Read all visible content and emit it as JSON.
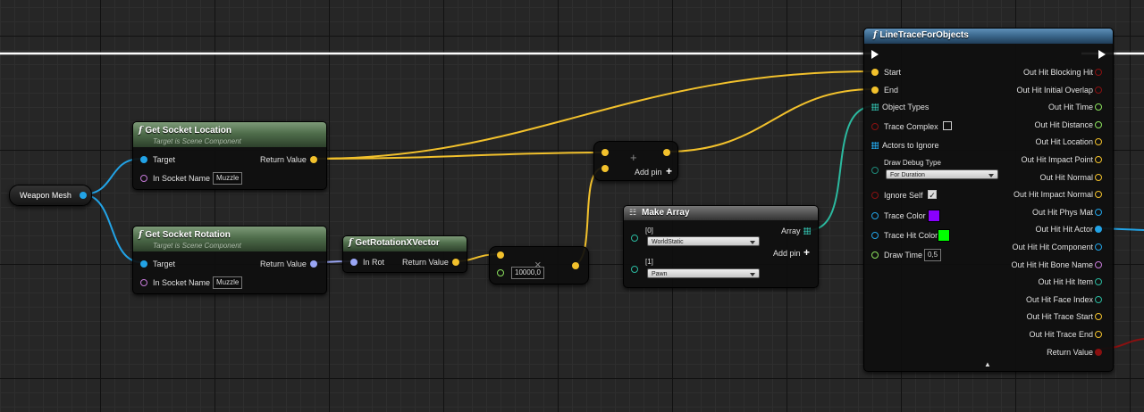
{
  "colors": {
    "exec": "#ffffff",
    "vector": "#f2c12c",
    "rotator": "#9aa6f5",
    "object": "#22a3e6",
    "name": "#c57ad8",
    "bool": "#8a1010",
    "float": "#8ce25d",
    "struct": "#2bb99f"
  },
  "weapon_mesh": {
    "label": "Weapon Mesh"
  },
  "get_socket_location": {
    "title": "Get Socket Location",
    "subtitle": "Target is Scene Component",
    "target": "Target",
    "socket_name": "In Socket Name",
    "socket_value": "Muzzle",
    "return_value": "Return Value"
  },
  "get_socket_rotation": {
    "title": "Get Socket Rotation",
    "subtitle": "Target is Scene Component",
    "target": "Target",
    "socket_name": "In Socket Name",
    "socket_value": "Muzzle",
    "return_value": "Return Value"
  },
  "get_rotation_x": {
    "title": "GetRotationXVector",
    "in_rot": "In Rot",
    "return_value": "Return Value"
  },
  "multiply": {
    "symbol": "×",
    "value": "10000,0"
  },
  "add": {
    "symbol": "+",
    "add_pin": "Add pin"
  },
  "make_array": {
    "title": "Make Array",
    "item0": "[0]",
    "item0_value": "WorldStatic",
    "item1": "[1]",
    "item1_value": "Pawn",
    "array": "Array",
    "add_pin": "Add pin"
  },
  "line_trace": {
    "title": "LineTraceForObjects",
    "inputs": {
      "start": "Start",
      "end": "End",
      "object_types": "Object Types",
      "trace_complex": "Trace Complex",
      "actors_to_ignore": "Actors to Ignore",
      "draw_debug_type": "Draw Debug Type",
      "draw_debug_value": "For Duration",
      "ignore_self": "Ignore Self",
      "trace_color": "Trace Color",
      "trace_hit_color": "Trace Hit Color",
      "draw_time": "Draw Time",
      "draw_time_value": "0,5"
    },
    "outputs": [
      "Out Hit Blocking Hit",
      "Out Hit Initial Overlap",
      "Out Hit Time",
      "Out Hit Distance",
      "Out Hit Location",
      "Out Hit Impact Point",
      "Out Hit Normal",
      "Out Hit Impact Normal",
      "Out Hit Phys Mat",
      "Out Hit Hit Actor",
      "Out Hit Hit Component",
      "Out Hit Hit Bone Name",
      "Out Hit Hit Item",
      "Out Hit Face Index",
      "Out Hit Trace Start",
      "Out Hit Trace End",
      "Return Value"
    ],
    "trace_color": "#8a00ff",
    "trace_hit_color": "#00ff00"
  },
  "check_mark": "✓",
  "collapse_arrow": "▲"
}
